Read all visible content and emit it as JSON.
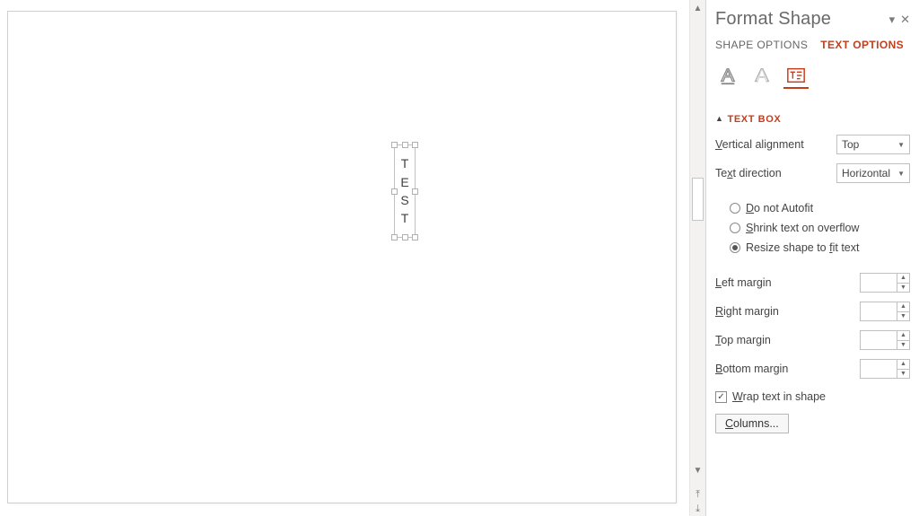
{
  "pane": {
    "title": "Format Shape",
    "tabs": {
      "shape": "SHAPE OPTIONS",
      "text": "TEXT OPTIONS"
    },
    "section": "TEXT BOX",
    "vlabel": "Vertical alignment",
    "vvalue": "Top",
    "dlabel": "Text direction",
    "dvalue": "Horizontal",
    "r1": "Do not Autofit",
    "r2": "Shrink text on overflow",
    "r3": "Resize shape to fit text",
    "m_left": "Left margin",
    "m_right": "Right margin",
    "m_top": "Top margin",
    "m_bottom": "Bottom margin",
    "wrap": "Wrap text in shape",
    "columns": "Columns..."
  },
  "textbox": {
    "c0": "T",
    "c1": "E",
    "c2": "S",
    "c3": "T"
  }
}
